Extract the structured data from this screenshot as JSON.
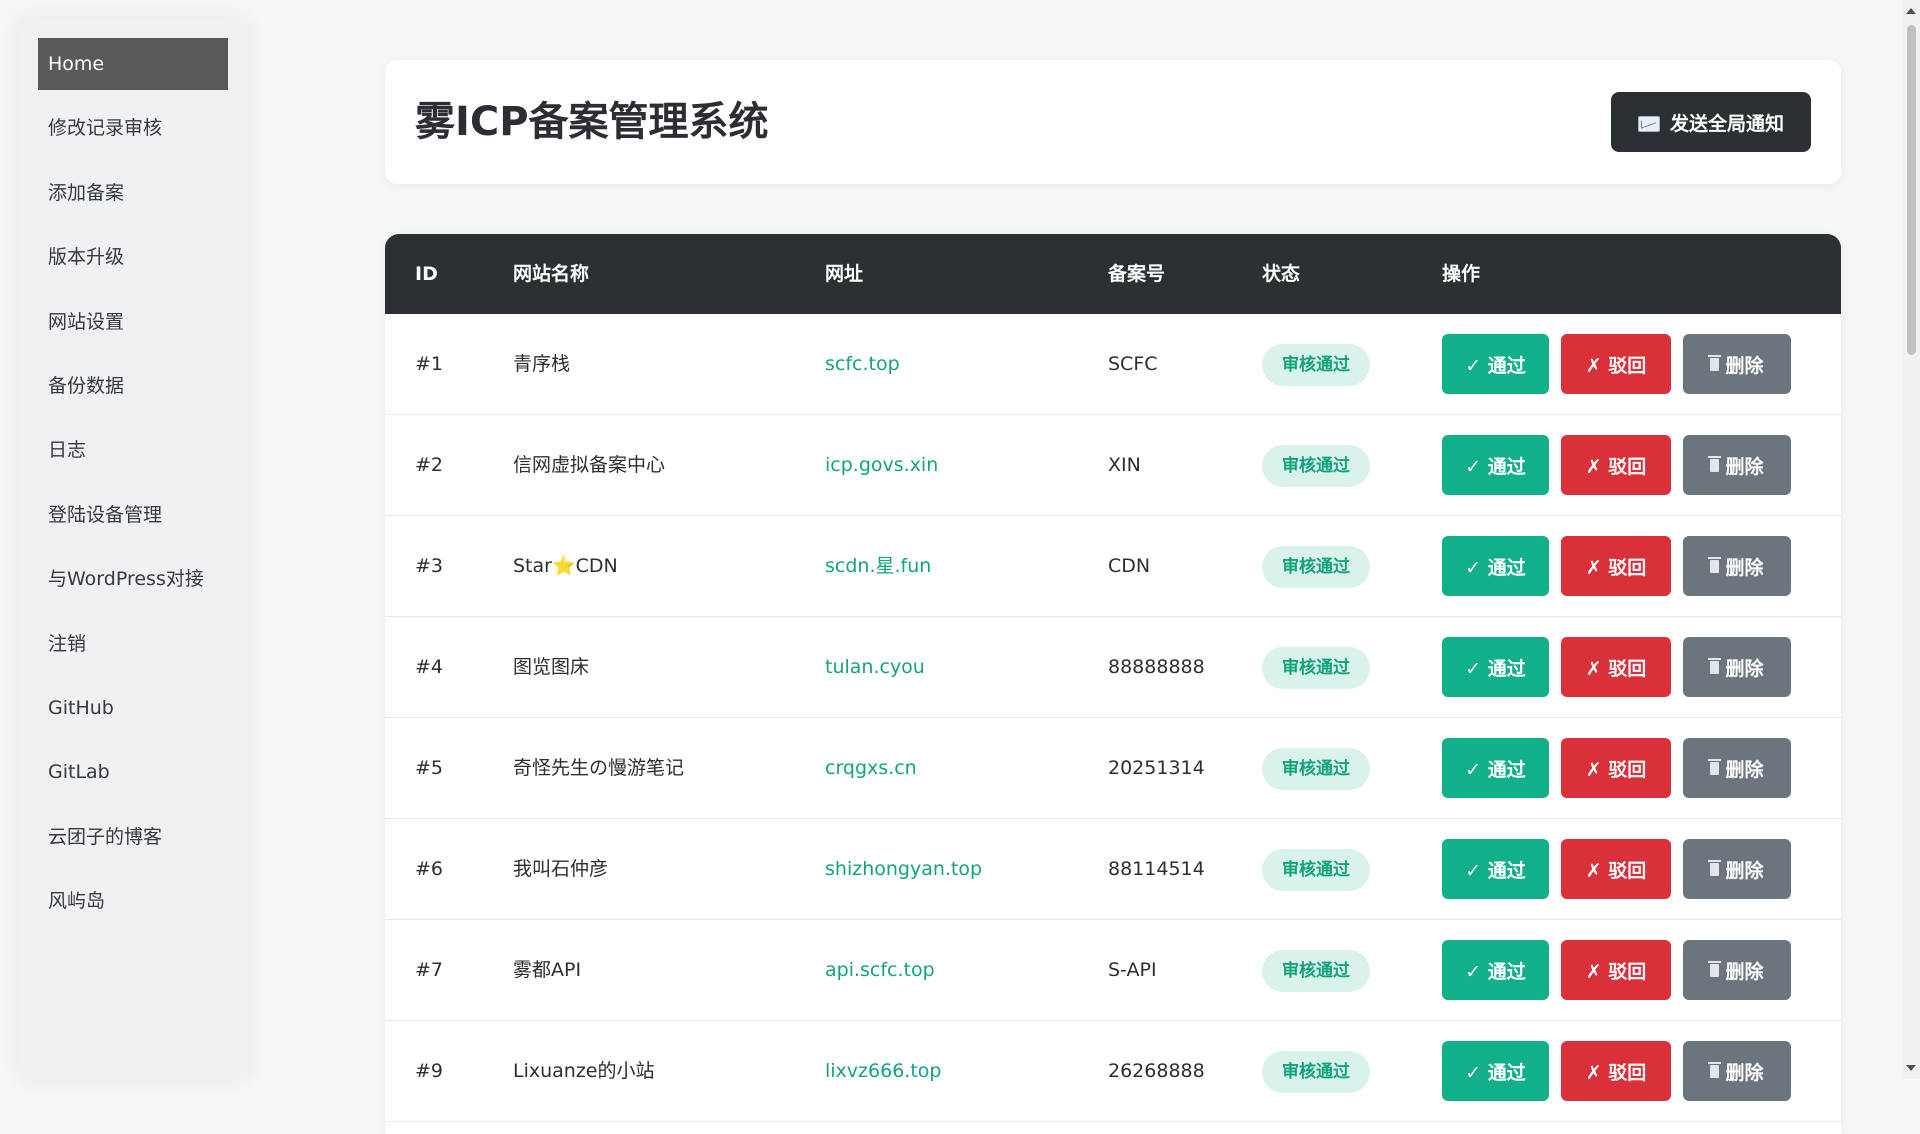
{
  "sidebar": {
    "items": [
      {
        "label": "Home",
        "active": true
      },
      {
        "label": "修改记录审核"
      },
      {
        "label": "添加备案"
      },
      {
        "label": "版本升级"
      },
      {
        "label": "网站设置"
      },
      {
        "label": "备份数据"
      },
      {
        "label": "日志"
      },
      {
        "label": "登陆设备管理"
      },
      {
        "label": "与WordPress对接"
      },
      {
        "label": "注销"
      },
      {
        "label": "GitHub"
      },
      {
        "label": "GitLab"
      },
      {
        "label": "云团子的博客"
      },
      {
        "label": "风屿岛"
      }
    ]
  },
  "header": {
    "title": "雾ICP备案管理系统",
    "notify_label": "发送全局通知",
    "notify_icon": "envelope-icon"
  },
  "table": {
    "columns": [
      "ID",
      "网站名称",
      "网址",
      "备案号",
      "状态",
      "操作"
    ],
    "actions": {
      "approve": "✓ 通过",
      "reject": "✗ 驳回",
      "delete": "删除"
    },
    "rows": [
      {
        "id": "#1",
        "name": "青序栈",
        "url": "scfc.top",
        "icp": "SCFC",
        "status": "审核通过"
      },
      {
        "id": "#2",
        "name": "信网虚拟备案中心",
        "url": "icp.govs.xin",
        "icp": "XIN",
        "status": "审核通过"
      },
      {
        "id": "#3",
        "name_parts": [
          "Star",
          "⭐",
          "CDN"
        ],
        "url": "scdn.星.fun",
        "icp": "CDN",
        "status": "审核通过"
      },
      {
        "id": "#4",
        "name": "图览图床",
        "url": "tulan.cyou",
        "icp": "88888888",
        "status": "审核通过"
      },
      {
        "id": "#5",
        "name": "奇怪先生の慢游笔记",
        "url": "crqgxs.cn",
        "icp": "20251314",
        "status": "审核通过"
      },
      {
        "id": "#6",
        "name": "我叫石仲彦",
        "url": "shizhongyan.top",
        "icp": "88114514",
        "status": "审核通过"
      },
      {
        "id": "#7",
        "name": "雾都API",
        "url": "api.scfc.top",
        "icp": "S-API",
        "status": "审核通过"
      },
      {
        "id": "#9",
        "name": "Lixuanze的小站",
        "url": "lixvz666.top",
        "icp": "26268888",
        "status": "审核通过"
      }
    ]
  },
  "colors": {
    "accent_green": "#12b08a",
    "danger_red": "#d9303a",
    "neutral_gray": "#6c757d",
    "dark_header": "#2b3033",
    "link_green": "#14a37f",
    "badge_bg": "#d9f3ec"
  }
}
